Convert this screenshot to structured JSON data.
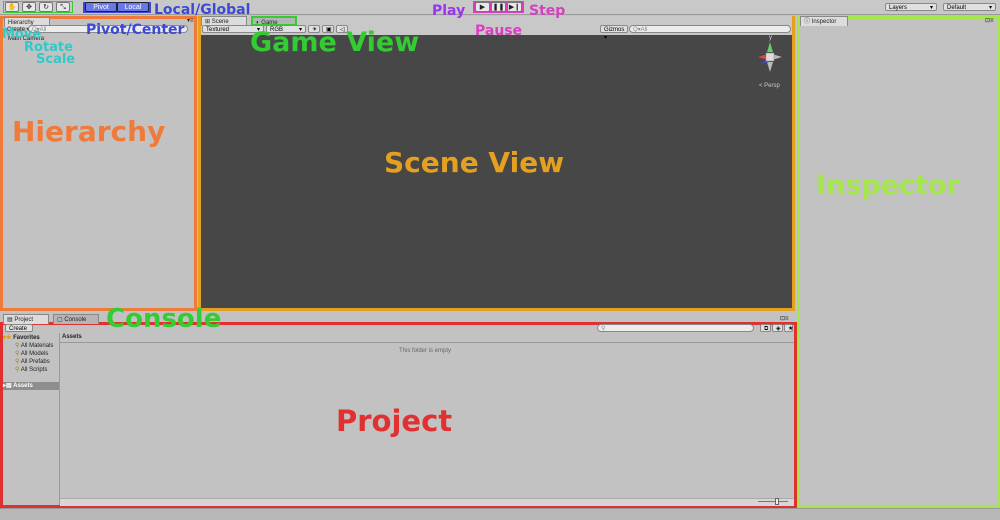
{
  "toolbar": {
    "pivot_label": "Pivot",
    "local_label": "Local",
    "play_glyph": "▶",
    "pause_glyph": "❚❚",
    "step_glyph": "▶❙",
    "layers_label": "Layers",
    "layout_label": "Default"
  },
  "hierarchy": {
    "tab": "Hierarchy",
    "create": "Create ▾",
    "search_placeholder": "Q▾All",
    "items": [
      "Main Camera"
    ]
  },
  "scene": {
    "tab_scene": "Scene",
    "tab_game": "Game",
    "textured": "Textured",
    "rgb": "RGB",
    "gizmos": "Gizmos ▾",
    "search_placeholder": "Q▾All",
    "persp": "< Persp",
    "gizmo_y": "y"
  },
  "inspector": {
    "tab": "Inspector"
  },
  "project": {
    "tab_project": "Project",
    "tab_console": "Console",
    "create": "Create ▾",
    "favorites_label": "Favorites",
    "favorites": [
      "All Materials",
      "All Models",
      "All Prefabs",
      "All Scripts"
    ],
    "assets_root": "Assets",
    "assets_header": "Assets",
    "empty_message": "This folder is empty"
  },
  "annotations": {
    "move": "Move",
    "rotate": "Rotate",
    "scale": "Scale",
    "pivot_center": "Pivot/Center",
    "local_global": "Local/Global",
    "play": "Play",
    "pause": "Pause",
    "step": "Step",
    "game_view": "Game View",
    "scene_view": "Scene View",
    "hierarchy": "Hierarchy",
    "inspector": "Inspector",
    "console": "Console",
    "project": "Project"
  },
  "colors": {
    "hierarchy": "#f07a3a",
    "scene": "#e6a020",
    "game": "#33cc33",
    "inspector": "#a6e64d",
    "project": "#e03030",
    "pivot": "#3a4ad6",
    "play": "#9933ee",
    "pause": "#d640c0",
    "transform": "#33c8c8"
  }
}
